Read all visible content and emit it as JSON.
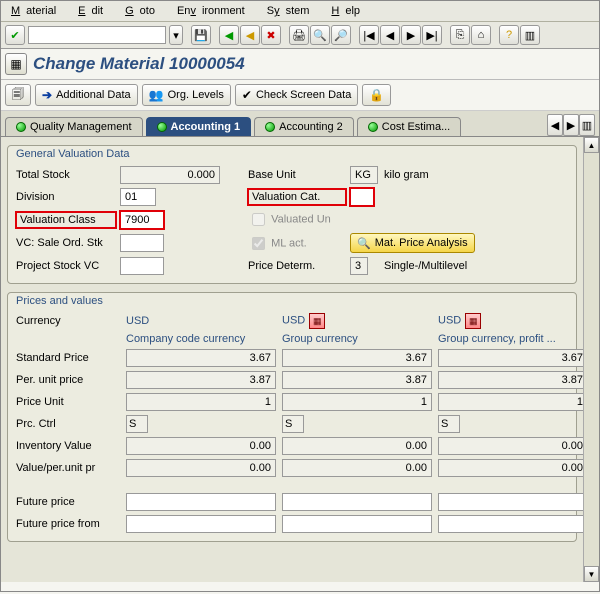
{
  "menu": {
    "m1": "Material",
    "m2": "Edit",
    "m3": "Goto",
    "m4": "Environment",
    "m5": "System",
    "m6": "Help"
  },
  "title": "Change Material 10000054",
  "appbar": {
    "additional": "Additional Data",
    "org": "Org. Levels",
    "check": "Check Screen Data"
  },
  "tabs": {
    "t1": "Quality Management",
    "t2": "Accounting 1",
    "t3": "Accounting 2",
    "t4": "Cost Estima..."
  },
  "gvd": {
    "title": "General Valuation Data",
    "total_stock_l": "Total Stock",
    "total_stock_v": "0.000",
    "base_unit_l": "Base Unit",
    "base_unit_v": "KG",
    "base_unit_t": "kilo gram",
    "division_l": "Division",
    "division_v": "01",
    "val_cat_l": "Valuation Cat.",
    "val_cat_v": "",
    "val_class_l": "Valuation Class",
    "val_class_v": "7900",
    "valuated_l": "Valuated Un",
    "vc_sale_l": "VC: Sale Ord. Stk",
    "ml_act_l": "ML act.",
    "mat_price_btn": "Mat. Price Analysis",
    "proj_stock_l": "Project Stock VC",
    "price_determ_l": "Price Determ.",
    "price_determ_v": "3",
    "price_determ_t": "Single-/Multilevel"
  },
  "pv": {
    "title": "Prices and values",
    "currency_l": "Currency",
    "c1": "USD",
    "c2": "USD",
    "c3": "USD",
    "h1": "Company code currency",
    "h2": "Group currency",
    "h3": "Group currency, profit ...",
    "std_l": "Standard Price",
    "std1": "3.67",
    "std2": "3.67",
    "std3": "3.67",
    "per_l": "Per. unit price",
    "per1": "3.87",
    "per2": "3.87",
    "per3": "3.87",
    "pu_l": "Price Unit",
    "pu1": "1",
    "pu2": "1",
    "pu3": "1",
    "pc_l": "Prc. Ctrl",
    "pc1": "S",
    "pc2": "S",
    "pc3": "S",
    "inv_l": "Inventory Value",
    "inv1": "0.00",
    "inv2": "0.00",
    "inv3": "0.00",
    "vpu_l": "Value/per.unit pr",
    "vpu1": "0.00",
    "vpu2": "0.00",
    "vpu3": "0.00",
    "fp_l": "Future price",
    "fpf_l": "Future price from"
  }
}
